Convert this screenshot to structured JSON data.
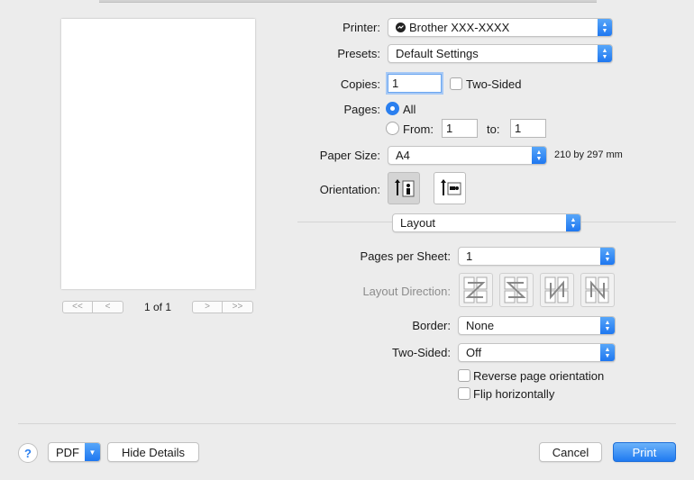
{
  "preview": {
    "nav_first": "<<",
    "nav_prev": "<",
    "nav_next": ">",
    "nav_last": ">>",
    "page_indicator": "1 of 1"
  },
  "printer": {
    "label": "Printer:",
    "value": "Brother XXX-XXXX",
    "icon": "printer-status-icon"
  },
  "presets": {
    "label": "Presets:",
    "value": "Default Settings"
  },
  "copies": {
    "label": "Copies:",
    "value": "1",
    "two_sided_label": "Two-Sided",
    "two_sided_checked": false
  },
  "pages": {
    "label": "Pages:",
    "all_label": "All",
    "from_label": "From:",
    "from_value": "1",
    "to_label": "to:",
    "to_value": "1",
    "selected": "all"
  },
  "paper_size": {
    "label": "Paper Size:",
    "value": "A4",
    "dimensions": "210 by 297 mm"
  },
  "orientation": {
    "label": "Orientation:",
    "options": [
      "portrait",
      "landscape"
    ],
    "selected": "portrait"
  },
  "section": {
    "value": "Layout"
  },
  "layout": {
    "pages_per_sheet_label": "Pages per Sheet:",
    "pages_per_sheet_value": "1",
    "layout_direction_label": "Layout Direction:",
    "border_label": "Border:",
    "border_value": "None",
    "two_sided_label": "Two-Sided:",
    "two_sided_value": "Off",
    "reverse_label": "Reverse page orientation",
    "flip_label": "Flip horizontally"
  },
  "footer": {
    "help": "?",
    "pdf": "PDF",
    "hide_details": "Hide Details",
    "cancel": "Cancel",
    "print": "Print"
  },
  "colors": {
    "accent": "#2a7fef",
    "background": "#ececec"
  }
}
